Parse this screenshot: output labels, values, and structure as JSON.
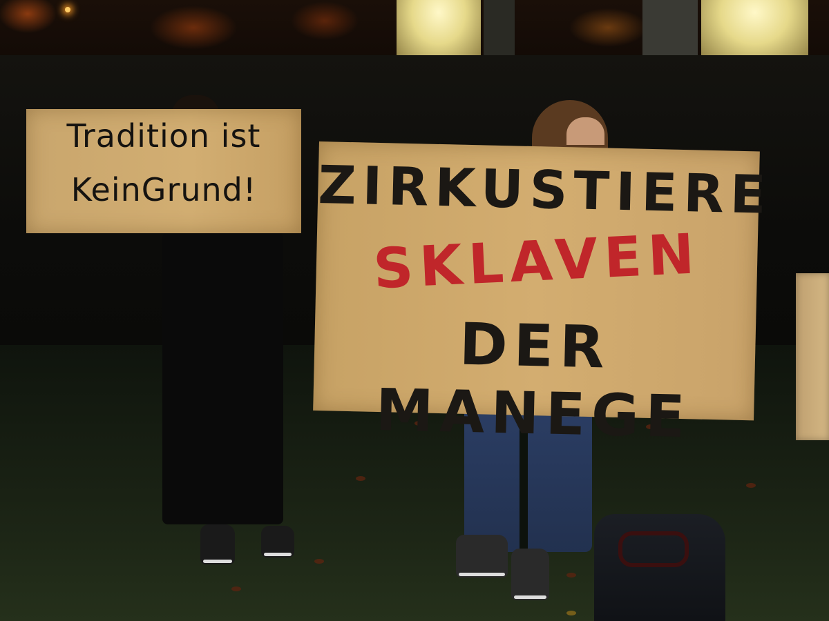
{
  "photo": {
    "signs": {
      "left": {
        "line1": "Tradition ist",
        "line2": "KeinGrund!"
      },
      "main": {
        "line1": "ZIRKUSTIERE",
        "line2": "SKLAVEN",
        "line3": "DER MANEGE",
        "highlight_color": "#c0262a",
        "text_color": "#1b1814"
      }
    }
  }
}
